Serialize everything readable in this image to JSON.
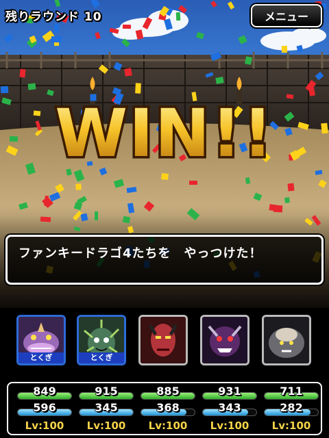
{
  "hud": {
    "round_label": "残りラウンド 10",
    "menu_label": "メニュー"
  },
  "banner": {
    "text": "WIN!!"
  },
  "message": {
    "text": "ファンキードラゴ4たちを　やっつけた！"
  },
  "party": [
    {
      "hp": "849",
      "mp": "596",
      "level": "Lv:100",
      "hp_ratio": 1.0,
      "mp_ratio": 1.0,
      "tag": "とくぎ",
      "selected": true,
      "color": "#9a6ab8",
      "icon": "purple-dragon-icon"
    },
    {
      "hp": "915",
      "mp": "345",
      "level": "Lv:100",
      "hp_ratio": 1.0,
      "mp_ratio": 1.0,
      "tag": "とくぎ",
      "selected": true,
      "color": "#4a7a5a",
      "icon": "thorned-plant-monster-icon"
    },
    {
      "hp": "885",
      "mp": "368",
      "level": "Lv:100",
      "hp_ratio": 1.0,
      "mp_ratio": 0.84,
      "tag": "",
      "selected": false,
      "color": "#b3343a",
      "icon": "red-demon-icon"
    },
    {
      "hp": "931",
      "mp": "343",
      "level": "Lv:100",
      "hp_ratio": 1.0,
      "mp_ratio": 0.85,
      "tag": "",
      "selected": false,
      "color": "#5a2a6a",
      "icon": "purple-demon-icon"
    },
    {
      "hp": "711",
      "mp": "282",
      "level": "Lv:100",
      "hp_ratio": 1.0,
      "mp_ratio": 0.86,
      "tag": "",
      "selected": false,
      "color": "#6a6a70",
      "icon": "gray-beast-icon"
    }
  ],
  "colors": {
    "hp": "#2fae2a",
    "mp": "#1f93d6",
    "win_gold": "#f2b21a",
    "level": "#f5d34a"
  }
}
